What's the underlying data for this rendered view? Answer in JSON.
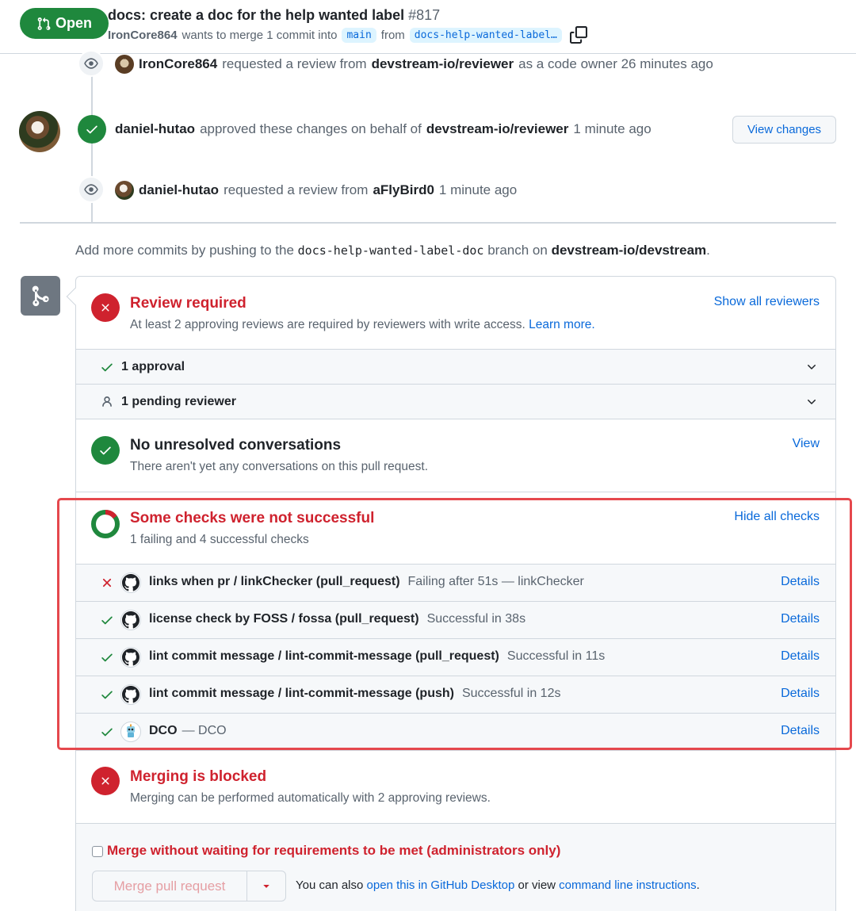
{
  "header": {
    "state": "Open",
    "title": "docs: create a doc for the help wanted label",
    "number": "#817",
    "author": "IronCore864",
    "meta_text": "wants to merge 1 commit into",
    "base_branch": "main",
    "from_text": "from",
    "head_branch": "docs-help-wanted-label…"
  },
  "timeline": [
    {
      "actor": "IronCore864",
      "text": "requested a review from",
      "target": "devstream-io/reviewer",
      "suffix": "as a code owner 26 minutes ago"
    },
    {
      "actor": "daniel-hutao",
      "text": "approved these changes on behalf of",
      "target": "devstream-io/reviewer",
      "suffix": "1 minute ago",
      "button": "View changes"
    },
    {
      "actor": "daniel-hutao",
      "text": "requested a review from",
      "target": "aFlyBird0",
      "suffix": "1 minute ago"
    }
  ],
  "push_hint": {
    "prefix": "Add more commits by pushing to the",
    "branch": "docs-help-wanted-label-doc",
    "middle": "branch on",
    "repo": "devstream-io/devstream",
    "end": "."
  },
  "review": {
    "title": "Review required",
    "subtitle": "At least 2 approving reviews are required by reviewers with write access.",
    "learn_more": "Learn more.",
    "link": "Show all reviewers",
    "approvals": "1 approval",
    "pending": "1 pending reviewer"
  },
  "conversations": {
    "title": "No unresolved conversations",
    "subtitle": "There aren't yet any conversations on this pull request.",
    "link": "View"
  },
  "checks": {
    "title": "Some checks were not successful",
    "subtitle": "1 failing and 4 successful checks",
    "link": "Hide all checks",
    "items": [
      {
        "status": "fail",
        "name": "links when pr / linkChecker (pull_request)",
        "desc": "Failing after 51s — linkChecker",
        "details": "Details"
      },
      {
        "status": "ok",
        "name": "license check by FOSS / fossa (pull_request)",
        "desc": "Successful in 38s",
        "details": "Details"
      },
      {
        "status": "ok",
        "name": "lint commit message / lint-commit-message (pull_request)",
        "desc": "Successful in 11s",
        "details": "Details"
      },
      {
        "status": "ok",
        "name": "lint commit message / lint-commit-message (push)",
        "desc": "Successful in 12s",
        "details": "Details"
      },
      {
        "status": "ok",
        "name": "DCO",
        "desc": "— DCO",
        "details": "Details"
      }
    ]
  },
  "merging": {
    "title": "Merging is blocked",
    "subtitle": "Merging can be performed automatically with 2 approving reviews.",
    "override": "Merge without waiting for requirements to be met (administrators only)",
    "button": "Merge pull request",
    "footer_prefix": "You can also",
    "footer_link1": "open this in GitHub Desktop",
    "footer_middle": "or view",
    "footer_link2": "command line instructions",
    "footer_end": "."
  },
  "colors": {
    "green": "#1f883d",
    "red": "#cf222e",
    "link": "#0969da",
    "highlight": "#e5484d"
  }
}
